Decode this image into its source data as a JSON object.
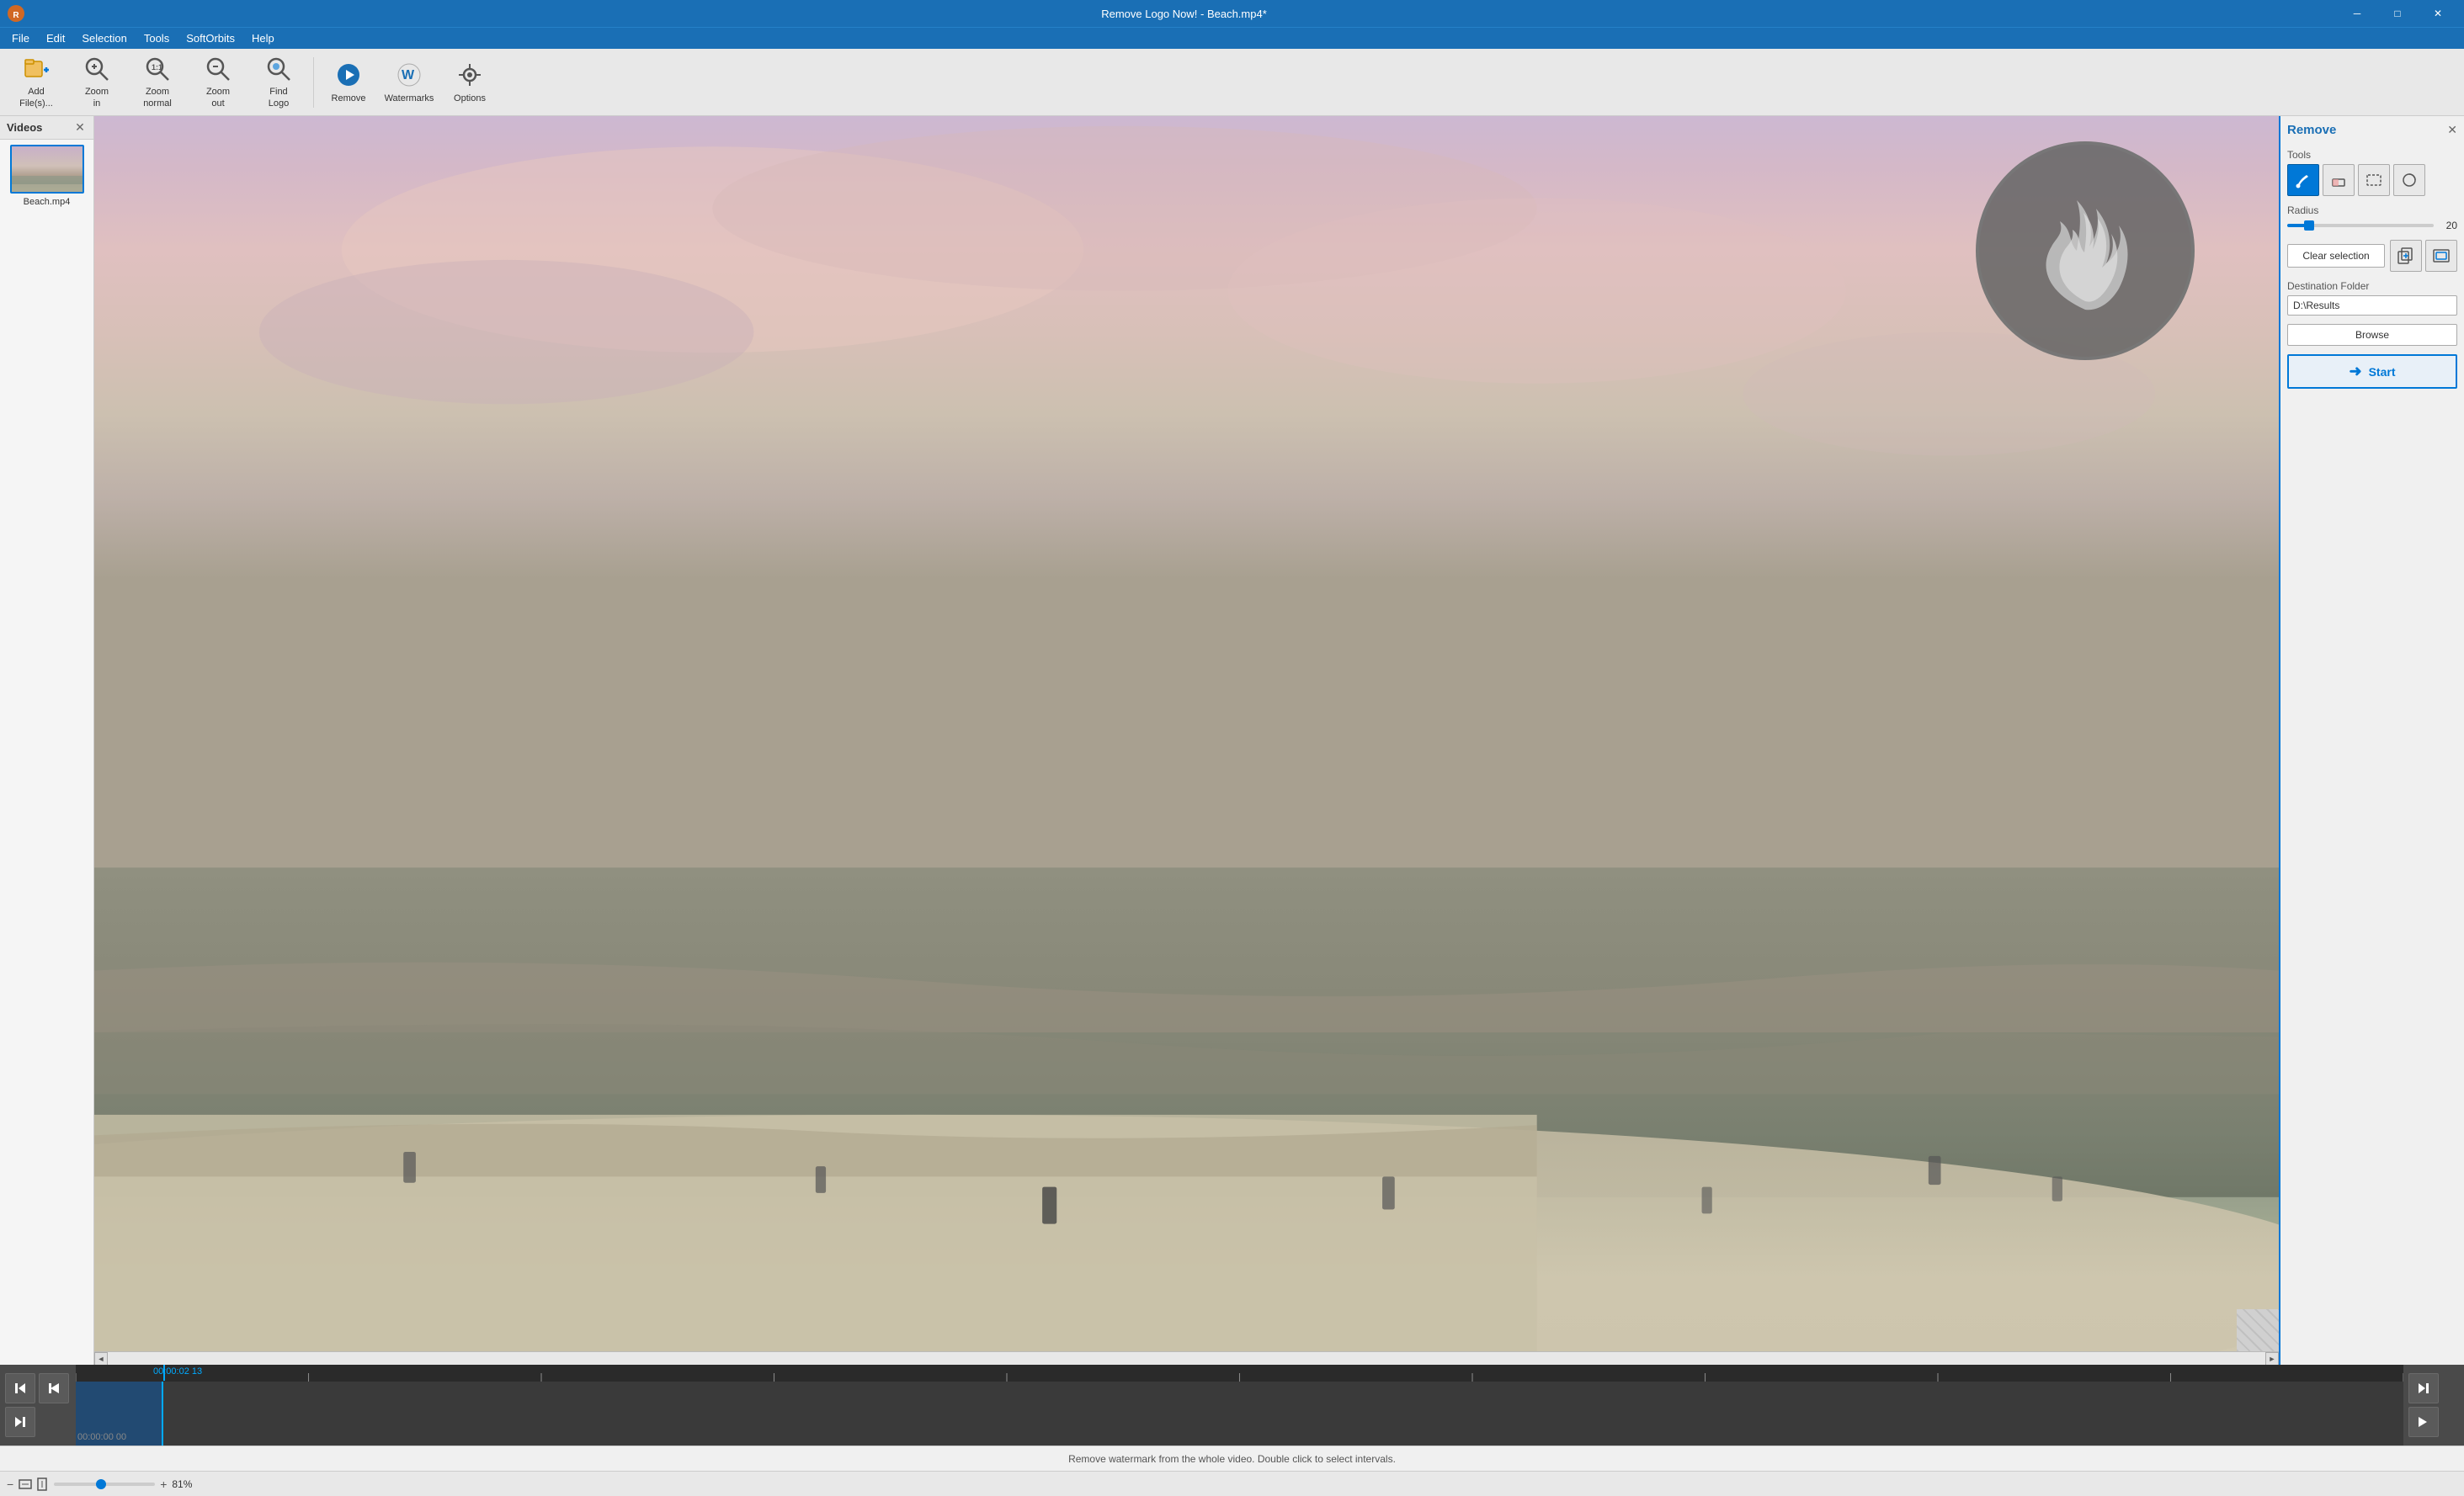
{
  "app": {
    "title": "Remove Logo Now! - Beach.mp4*"
  },
  "titlebar": {
    "minimize_label": "─",
    "maximize_label": "□",
    "close_label": "✕"
  },
  "menubar": {
    "items": [
      "File",
      "Edit",
      "Selection",
      "Tools",
      "SoftOrbits",
      "Help"
    ]
  },
  "toolbar": {
    "buttons": [
      {
        "id": "add-files",
        "label": "Add\nFile(s)...",
        "icon": "📁"
      },
      {
        "id": "zoom-in",
        "label": "Zoom\nin",
        "icon": "🔍"
      },
      {
        "id": "zoom-normal",
        "label": "Zoom\nnormal",
        "icon": "⊙"
      },
      {
        "id": "zoom-out",
        "label": "Zoom\nout",
        "icon": "🔍"
      },
      {
        "id": "find-logo",
        "label": "Find\nLogo",
        "icon": "🔎"
      },
      {
        "id": "remove",
        "label": "Remove",
        "icon": "▶"
      },
      {
        "id": "watermarks",
        "label": "Watermarks",
        "icon": "💧"
      },
      {
        "id": "options",
        "label": "Options",
        "icon": "⚙"
      }
    ]
  },
  "videos_panel": {
    "title": "Videos",
    "close_label": "✕",
    "items": [
      {
        "name": "Beach.mp4",
        "selected": true
      }
    ]
  },
  "right_panel": {
    "title": "Remove",
    "close_label": "✕",
    "tools_label": "Tools",
    "tools": [
      {
        "id": "brush",
        "icon": "✏",
        "active": true
      },
      {
        "id": "eraser",
        "icon": "⬚",
        "active": false
      },
      {
        "id": "rect",
        "icon": "▭",
        "active": false
      },
      {
        "id": "circle",
        "icon": "◷",
        "active": false
      }
    ],
    "radius_label": "Radius",
    "radius_value": 20,
    "clear_selection": "Clear selection",
    "destination_folder_label": "Destination Folder",
    "destination_folder_value": "D:\\Results",
    "browse_label": "Browse",
    "start_label": "Start",
    "start_arrow": "➜"
  },
  "timeline": {
    "current_time": "00:00:02 13",
    "start_time": "00:00:00 00",
    "play_icon": "▶",
    "skip_back_icon": "⏮",
    "skip_fwd_icon": "⏭",
    "prev_frame_icon": "◀",
    "next_frame_icon": "▶"
  },
  "statusbar": {
    "message": "Remove watermark from the whole video. Double click to select intervals."
  },
  "zoom": {
    "value": "81%",
    "minus_icon": "−",
    "plus_icon": "+"
  }
}
